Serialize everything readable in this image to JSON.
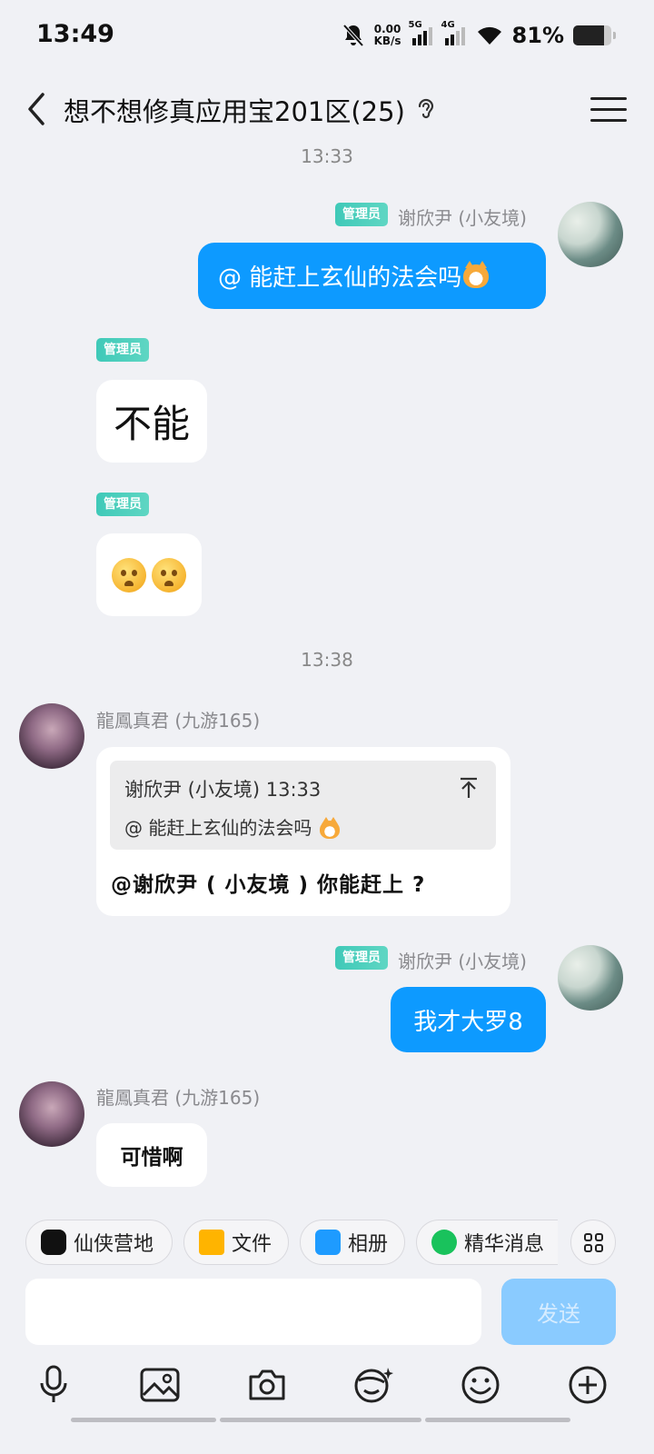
{
  "status": {
    "time": "13:49",
    "net_speed_value": "0.00",
    "net_speed_unit": "KB/s",
    "signal1_label": "5G",
    "signal2_label": "4G",
    "battery": "81%",
    "battery_level": 0.81,
    "icons": [
      "bell-off-icon",
      "signal-5g-icon",
      "signal-4g-icon",
      "wifi-icon",
      "battery-icon"
    ]
  },
  "header": {
    "title": "想不想修真应用宝201区(25)",
    "icons": [
      "back-icon",
      "ear-icon",
      "menu-icon"
    ]
  },
  "messages": {
    "time1": "13:33",
    "time2": "13:38",
    "m1": {
      "badge": "管理员",
      "sender": "谢欣尹 (小友境)",
      "text": "@  能赶上玄仙的法会吗"
    },
    "m2": {
      "badge": "管理员",
      "text": "不能"
    },
    "m3": {
      "badge": "管理员",
      "emoji": "pleading-face-icon x2"
    },
    "m4": {
      "sender": "龍鳳真君 (九游165)",
      "quote_meta": "谢欣尹 (小友境) 13:33",
      "quote_text": "@  能赶上玄仙的法会吗",
      "text": "@谢欣尹 ( 小友境 ) 你能赶上 ?"
    },
    "m5": {
      "badge": "管理员",
      "sender": "谢欣尹 (小友境)",
      "text": "我才大罗8"
    },
    "m6": {
      "sender": "龍鳳真君 (九游165)",
      "text": "可惜啊"
    }
  },
  "shortcuts": {
    "s1": "仙侠营地",
    "s2": "文件",
    "s3": "相册",
    "s4": "精华消息"
  },
  "composer": {
    "placeholder": "",
    "send": "发送",
    "tools": [
      "microphone-icon",
      "image-icon",
      "camera-icon",
      "sticker-icon",
      "emoji-icon",
      "plus-icon"
    ]
  },
  "colors": {
    "my_bubble": "#0d9aff",
    "badge": "#3fc9b8",
    "send_disabled": "#8acbff"
  }
}
